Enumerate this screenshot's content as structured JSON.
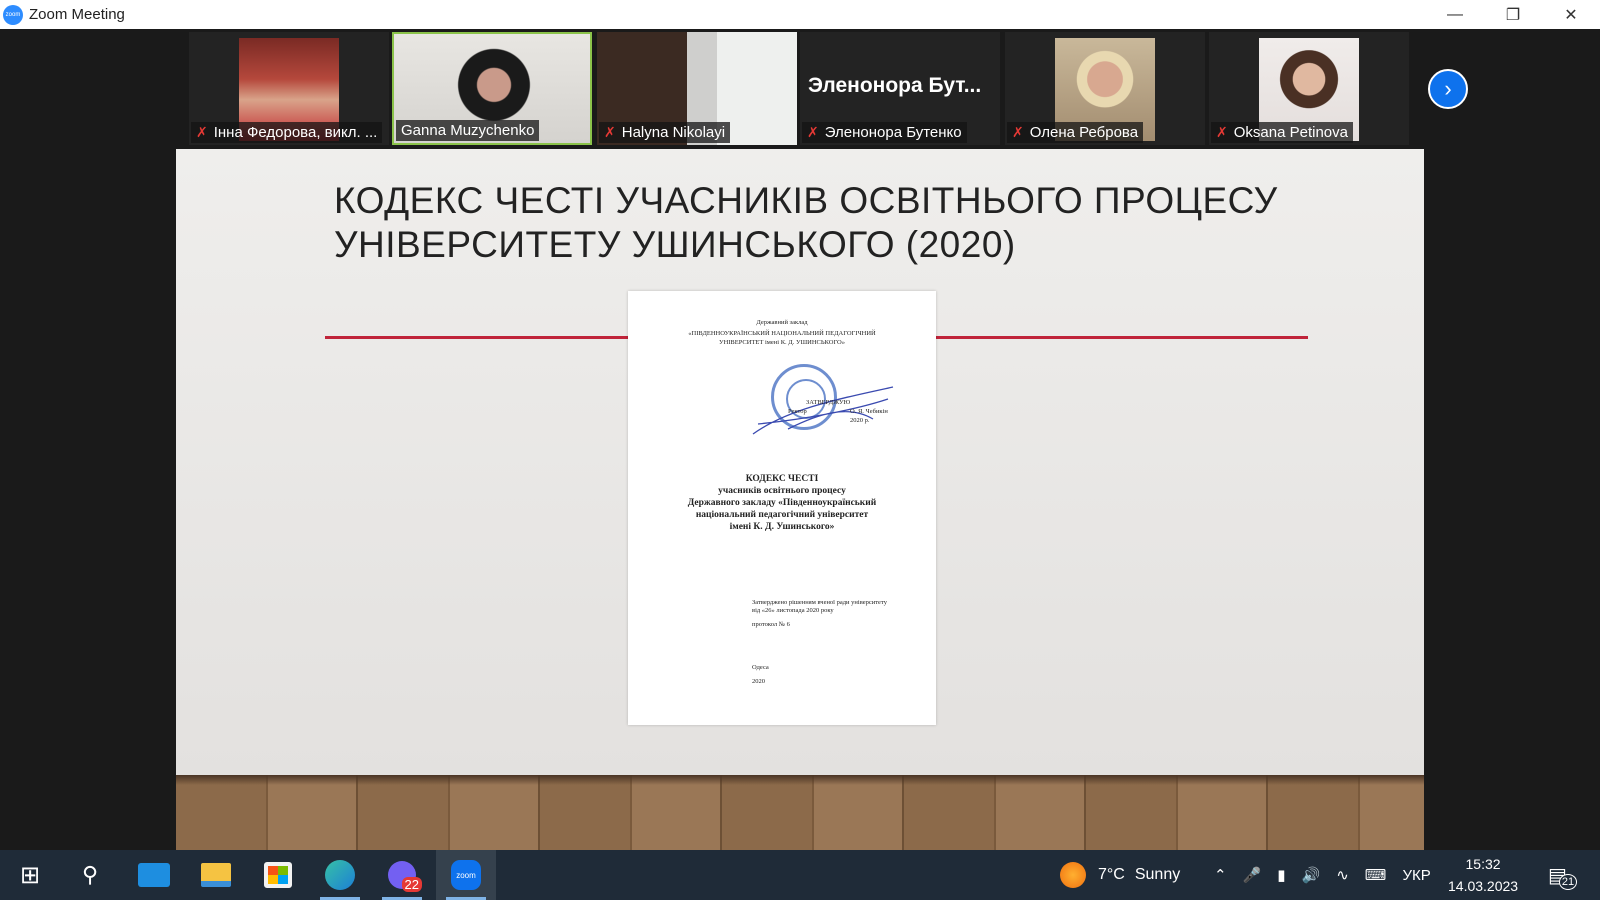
{
  "window": {
    "title": "Zoom Meeting",
    "logo": "zoom",
    "controls": [
      "minimize-icon",
      "restore-icon",
      "close-icon"
    ]
  },
  "participants": [
    {
      "name": "Інна Федорова, викл. ...",
      "muted": true,
      "video": true
    },
    {
      "name": "Ganna Muzychenko",
      "muted": false,
      "video": true,
      "active_speaker": true
    },
    {
      "name": "Halyna Nikolayi",
      "muted": true,
      "video": true
    },
    {
      "name": "Элленонора Бутенко",
      "display": "Эленонора  Бут...",
      "muted": true,
      "video": false
    },
    {
      "name": "Олена Реброва",
      "muted": true,
      "video": true
    },
    {
      "name": "Oksana Petinova",
      "muted": true,
      "video": true
    }
  ],
  "participants_label_4": "Эленонора Бутенко",
  "accent": "#0e72ed",
  "slide": {
    "title": "КОДЕКС ЧЕСТІ УЧАСНИКІВ ОСВІТНЬОГО ПРОЦЕСУ\nУНІВЕРСИТЕТУ УШИНСЬКОГО (2020)",
    "document": {
      "header1": "Державний заклад",
      "header2": "«ПІВДЕННОУКРАЇНСЬКИЙ НАЦІОНАЛЬНИЙ ПЕДАГОГІЧНИЙ",
      "header3": "УНІВЕРСИТЕТ імені К. Д. УШИНСЬКОГО»",
      "approve": "ЗАТВЕРДЖУЮ",
      "rector": "Ректор",
      "rector_name": "О. Я. Чебикін",
      "approve_date": "2020 р.",
      "title1": "КОДЕКС ЧЕСТІ",
      "title2": "учасників освітнього процесу",
      "title3": "Державного закладу «Південноукраїнський",
      "title4": "національний педагогічний університет",
      "title5": "імені К. Д. Ушинського»",
      "approved_line": "Затверджено рішенням вченої ради університету",
      "date_line": "від «26» листопада 2020 року",
      "protocol": "протокол № 6",
      "city": "Одеса",
      "year": "2020"
    }
  },
  "taskbar": {
    "apps": [
      {
        "name": "start",
        "icon": "windows-icon"
      },
      {
        "name": "search",
        "icon": "search-icon"
      },
      {
        "name": "mail",
        "icon": "mail-icon"
      },
      {
        "name": "file-explorer",
        "icon": "folder-icon"
      },
      {
        "name": "microsoft-store",
        "icon": "store-icon"
      },
      {
        "name": "edge",
        "icon": "edge-icon"
      },
      {
        "name": "viber",
        "icon": "viber-icon",
        "badge": "22"
      },
      {
        "name": "zoom",
        "icon": "zoom-icon",
        "label": "zoom"
      }
    ],
    "weather": {
      "temp": "7°C",
      "condition": "Sunny"
    },
    "language": "УКР",
    "time": "15:32",
    "date": "14.03.2023",
    "notifications": "21"
  }
}
